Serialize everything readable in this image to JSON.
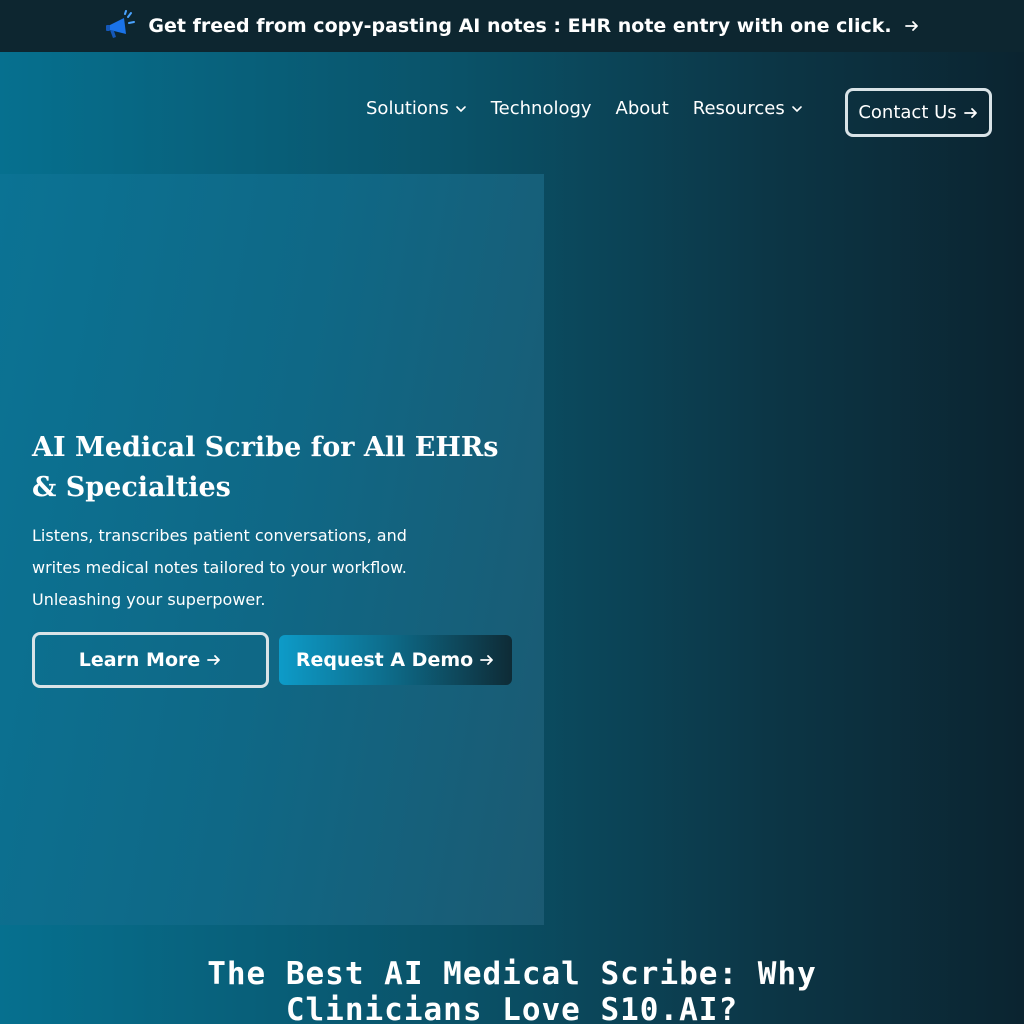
{
  "announcement": {
    "icon": "megaphone-icon",
    "text": "Get freed from copy-pasting AI notes : EHR note entry with one click."
  },
  "nav": {
    "items": [
      {
        "label": "Solutions",
        "has_dropdown": true
      },
      {
        "label": "Technology",
        "has_dropdown": false
      },
      {
        "label": "About",
        "has_dropdown": false
      },
      {
        "label": "Resources",
        "has_dropdown": true
      }
    ],
    "contact_label": "Contact Us"
  },
  "hero": {
    "title": "AI Medical Scribe for All EHRs & Specialties",
    "description": "Listens, transcribes patient conversations, and writes medical notes tailored to your workflow. Unleashing your superpower.",
    "learn_more_label": "Learn More",
    "request_demo_label": "Request A Demo"
  },
  "section": {
    "title": "The Best AI Medical Scribe: Why Clinicians Love S10.AI?"
  },
  "colors": {
    "announce_bg": "#0d2630",
    "page_gradient_start": "#06708f",
    "page_gradient_end": "#0b2430",
    "demo_button_start": "#0d9bc8",
    "megaphone_blue": "#1a73e8"
  }
}
